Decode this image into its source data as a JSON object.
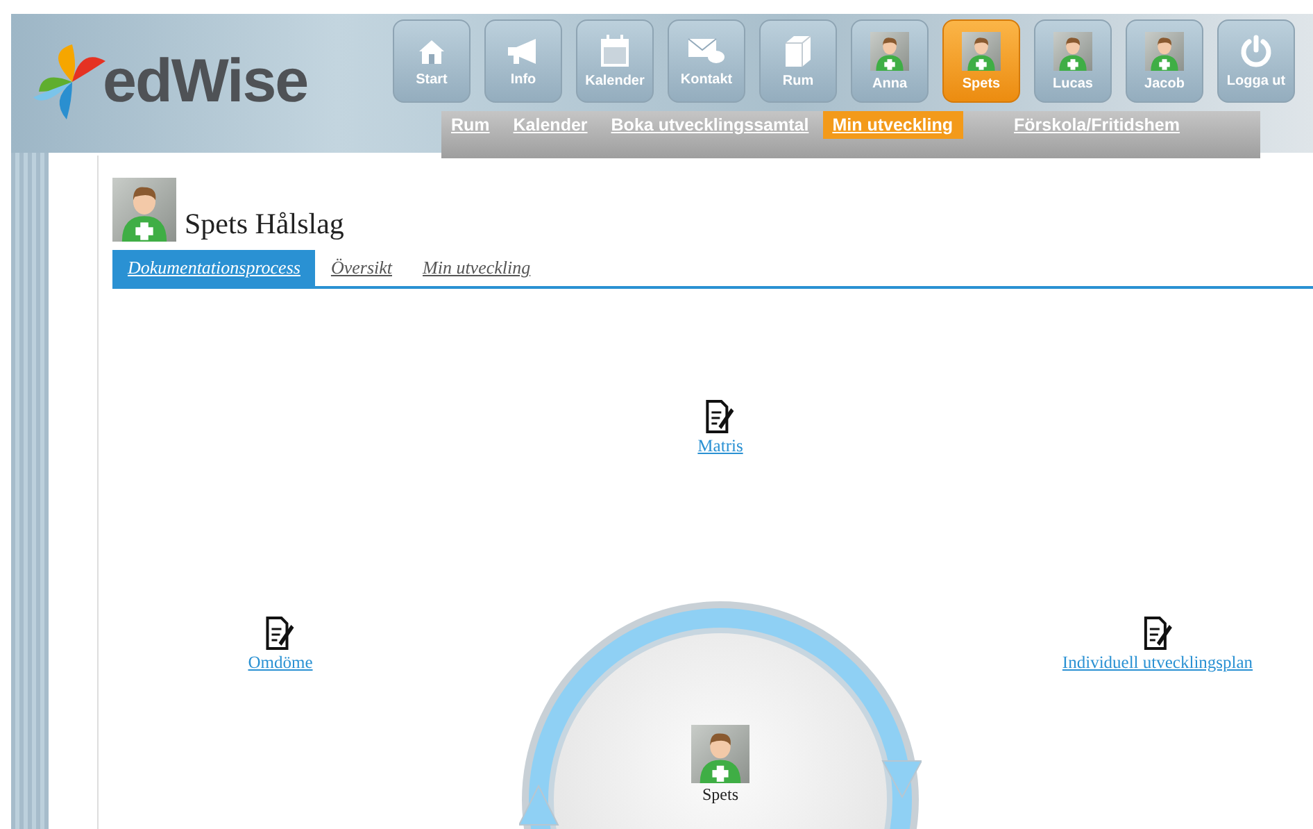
{
  "header": {
    "logo": "edWise",
    "nav": [
      {
        "label": "Start",
        "kind": "home",
        "selected": false
      },
      {
        "label": "Info",
        "kind": "megaphone",
        "selected": false
      },
      {
        "label": "Kalender",
        "kind": "calendar",
        "selected": false
      },
      {
        "label": "Kontakt",
        "kind": "mail",
        "selected": false
      },
      {
        "label": "Rum",
        "kind": "box",
        "selected": false
      },
      {
        "label": "Anna",
        "kind": "person",
        "selected": false
      },
      {
        "label": "Spets",
        "kind": "person",
        "selected": true
      },
      {
        "label": "Lucas",
        "kind": "person",
        "selected": false
      },
      {
        "label": "Jacob",
        "kind": "person",
        "selected": false
      },
      {
        "label": "Logga ut",
        "kind": "power",
        "selected": false
      }
    ],
    "subnav": [
      {
        "label": "Rum",
        "selected": false
      },
      {
        "label": "Kalender",
        "selected": false
      },
      {
        "label": "Boka utvecklingssamtal",
        "selected": false
      },
      {
        "label": "Min utveckling",
        "selected": true
      },
      {
        "label": "Förskola/Fritidshem",
        "selected": false
      }
    ]
  },
  "profile": {
    "name": "Spets Hålslag"
  },
  "tabs": [
    {
      "label": "Dokumentationsprocess",
      "selected": true
    },
    {
      "label": "Översikt",
      "selected": false
    },
    {
      "label": "Min utveckling",
      "selected": false
    }
  ],
  "diagram": {
    "nodes": [
      {
        "label": "Matris"
      },
      {
        "label": "Omdöme"
      },
      {
        "label": "Individuell utvecklingsplan"
      }
    ],
    "center": {
      "label": "Spets"
    }
  }
}
